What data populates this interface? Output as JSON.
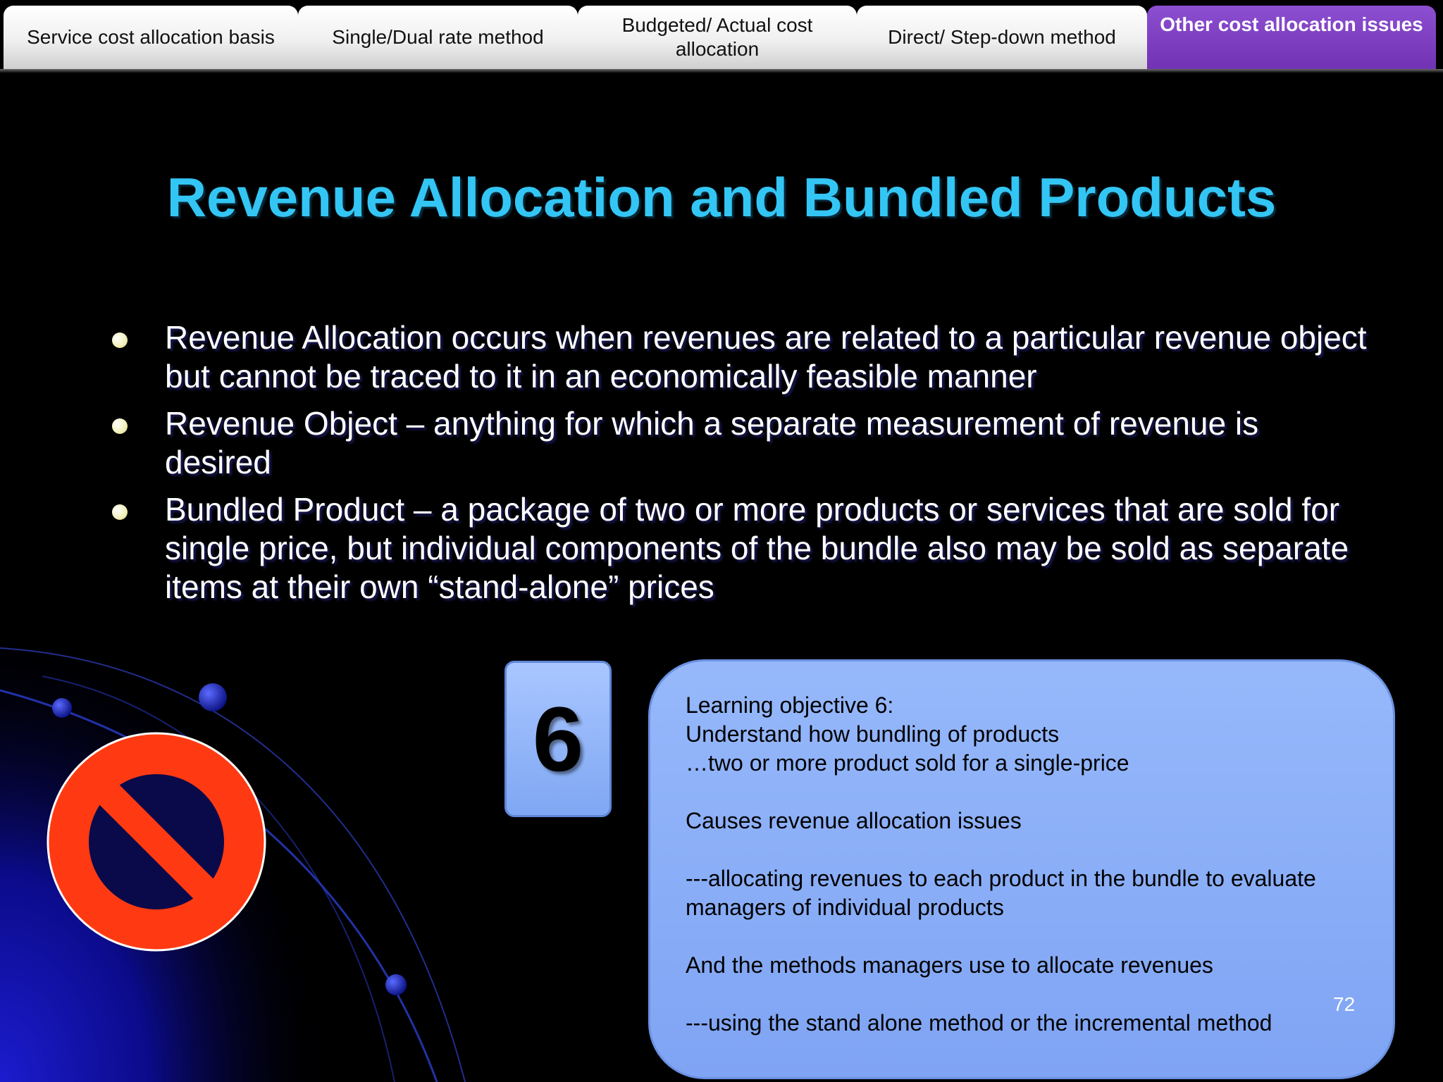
{
  "tabs": [
    {
      "label": "Service cost allocation basis",
      "active": false
    },
    {
      "label": "Single/Dual rate method",
      "active": false
    },
    {
      "label": "Budgeted/ Actual cost allocation",
      "active": false
    },
    {
      "label": "Direct/ Step-down method",
      "active": false
    },
    {
      "label": "Other cost allocation issues",
      "active": true
    }
  ],
  "slide": {
    "title": "Revenue Allocation and Bundled Products",
    "bullets": [
      "Revenue Allocation occurs when revenues are related to a particular revenue object but cannot be traced to it in an economically feasible manner",
      "Revenue Object – anything for which a separate measurement of revenue is desired",
      "Bundled Product – a package of two or more products or services that are sold for single price, but individual components of the bundle also may be sold as separate items at their own “stand-alone” prices"
    ],
    "objective_number": "6",
    "objective_lines": [
      "Learning objective 6:",
      "Understand how bundling of products",
      "…two or more product sold for a single-price",
      "",
      "Causes revenue allocation issues",
      "",
      "---allocating revenues to each product in the bundle to evaluate managers of individual products",
      "",
      "And the methods managers use to allocate revenues",
      "",
      "---using the stand alone method or the incremental method"
    ],
    "page_number": "72"
  },
  "colors": {
    "title": "#33c6f4",
    "active_tab": "#7133b3",
    "objective_box": "#8fb3fa",
    "prohibition_sign": "#ff3a12"
  },
  "icons": [
    "prohibition-icon"
  ]
}
